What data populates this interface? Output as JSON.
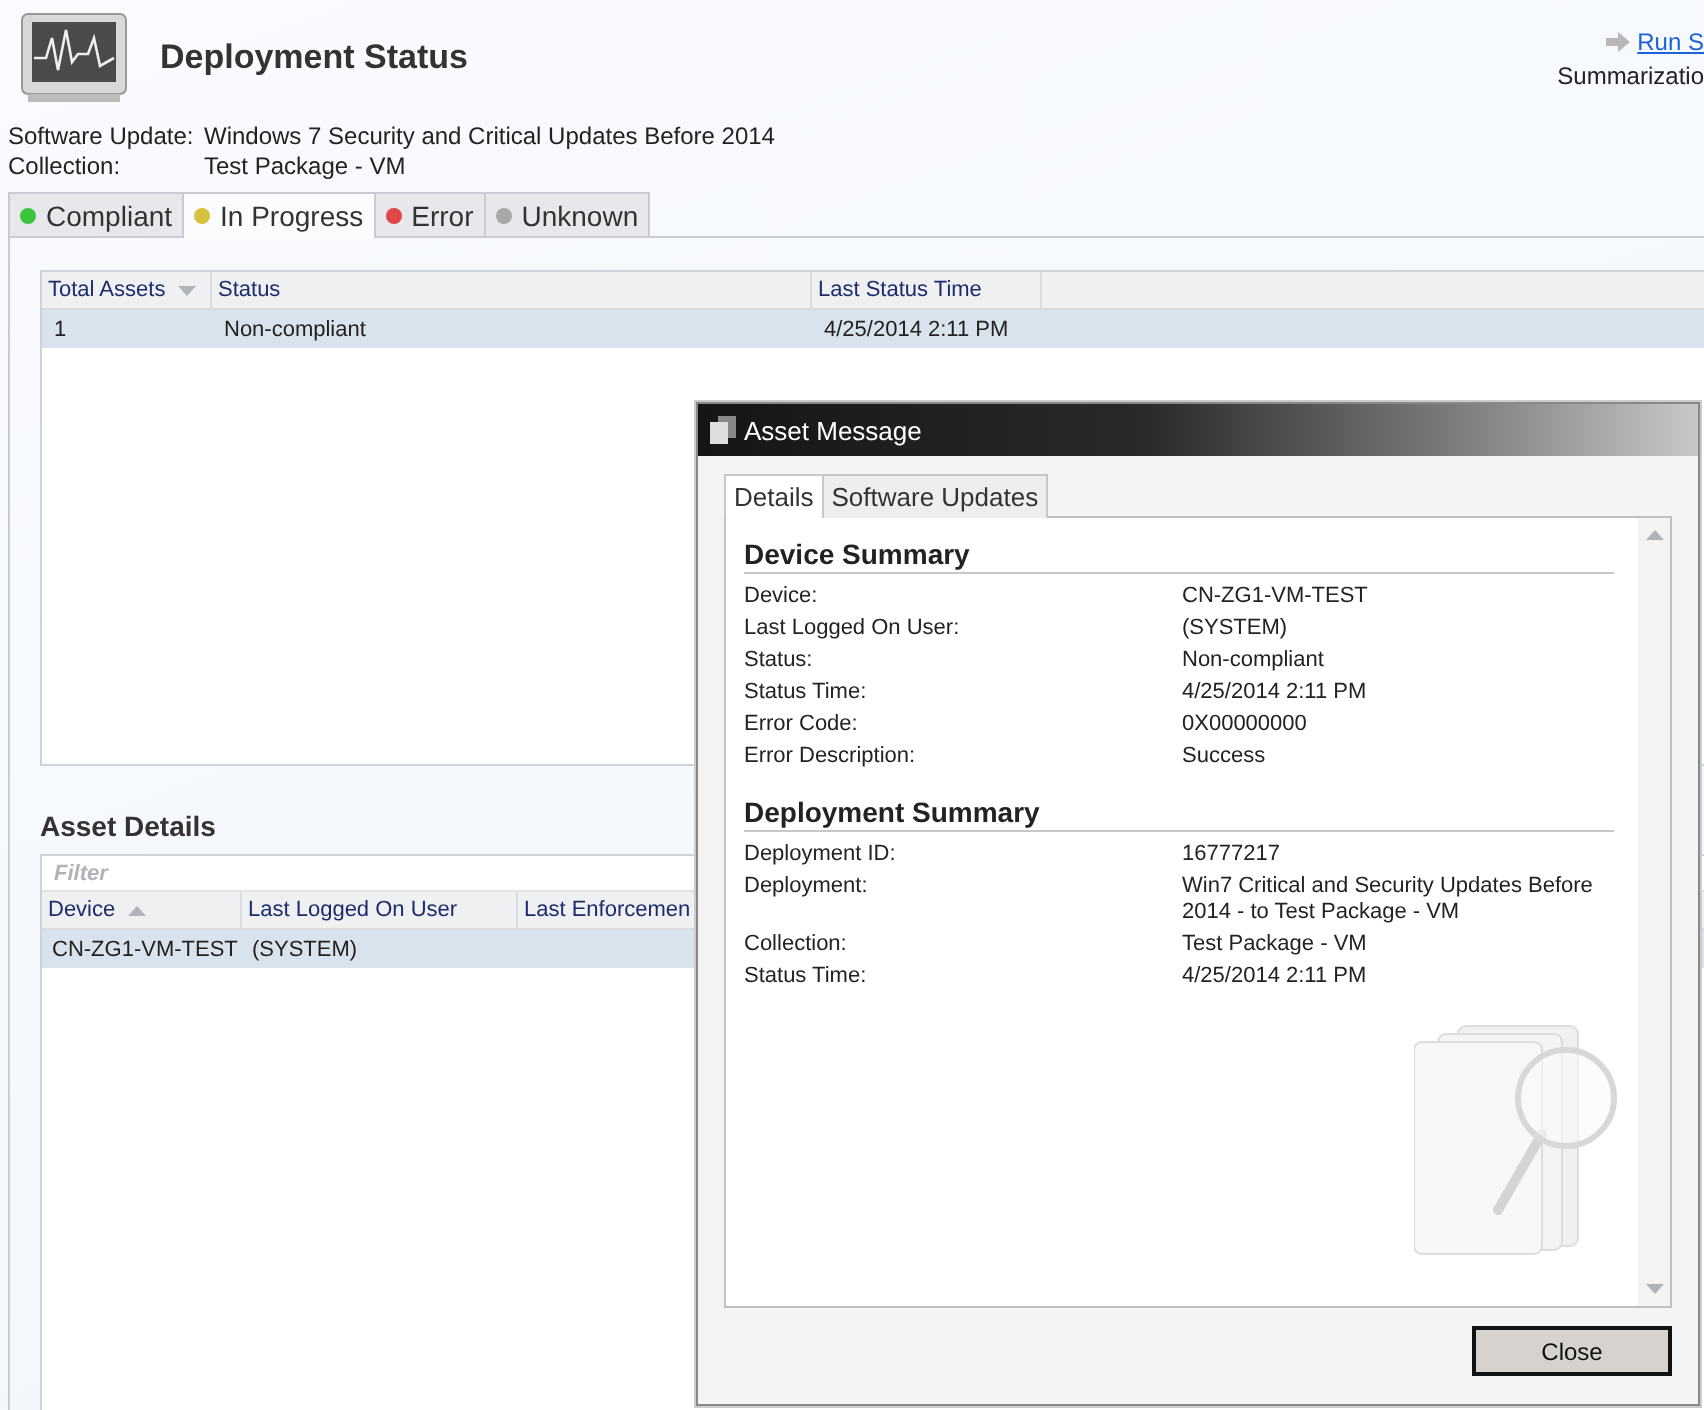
{
  "header": {
    "title": "Deployment Status",
    "run_link": "Run S",
    "run_caption": "Summarizatio"
  },
  "info": [
    {
      "label": "Software Update:",
      "value": "Windows 7 Security and Critical Updates Before 2014"
    },
    {
      "label": "Collection:",
      "value": "Test Package - VM"
    }
  ],
  "status_tabs": [
    {
      "label": "Compliant",
      "color": "#3cc43c",
      "selected": false
    },
    {
      "label": "In Progress",
      "color": "#d8c040",
      "selected": true
    },
    {
      "label": "Error",
      "color": "#e04848",
      "selected": false
    },
    {
      "label": "Unknown",
      "color": "#a8a8a8",
      "selected": false
    }
  ],
  "summary_table": {
    "columns": [
      {
        "label": "Total Assets",
        "sorted": true,
        "ascending": false
      },
      {
        "label": "Status"
      },
      {
        "label": "Last Status Time"
      }
    ],
    "rows": [
      {
        "cells": [
          "1",
          "Non-compliant",
          "4/25/2014 2:11 PM"
        ],
        "selected": true
      }
    ]
  },
  "asset_details": {
    "title": "Asset Details",
    "filter": {
      "placeholder": "Filter"
    },
    "columns": [
      {
        "label": "Device",
        "sorted": true,
        "ascending": true
      },
      {
        "label": "Last Logged On User"
      },
      {
        "label": "Last Enforcemen"
      }
    ],
    "rows": [
      {
        "cells": [
          "CN-ZG1-VM-TEST",
          "(SYSTEM)"
        ],
        "selected": true
      }
    ]
  },
  "dialog": {
    "title": "Asset Message",
    "tabs": [
      {
        "label": "Details",
        "selected": true
      },
      {
        "label": "Software Updates",
        "selected": false
      }
    ],
    "sections": [
      {
        "title": "Device Summary",
        "fields": [
          {
            "label": "Device:",
            "value": "CN-ZG1-VM-TEST"
          },
          {
            "label": "Last Logged On User:",
            "value": "(SYSTEM)"
          },
          {
            "label": "Status:",
            "value": "Non-compliant"
          },
          {
            "label": "Status Time:",
            "value": "4/25/2014 2:11 PM"
          },
          {
            "label": "Error Code:",
            "value": "0X00000000"
          },
          {
            "label": "Error Description:",
            "value": "Success"
          }
        ]
      },
      {
        "title": "Deployment Summary",
        "fields": [
          {
            "label": "Deployment ID:",
            "value": "16777217"
          },
          {
            "label": "Deployment:",
            "value": "Win7 Critical and Security Updates Before 2014 - to Test Package - VM"
          },
          {
            "label": "Collection:",
            "value": "Test Package - VM"
          },
          {
            "label": "Status Time:",
            "value": "4/25/2014 2:11 PM"
          }
        ]
      }
    ],
    "close_button": "Close"
  }
}
